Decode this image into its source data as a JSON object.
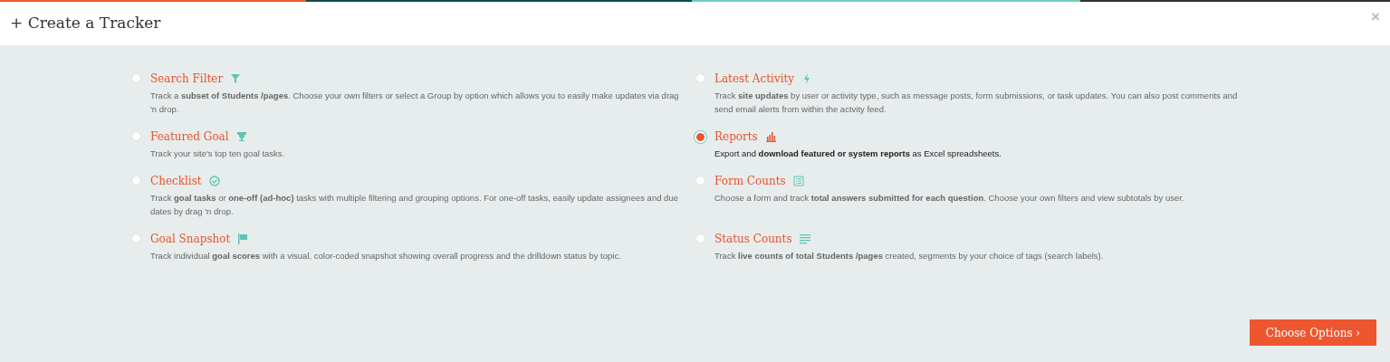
{
  "window": {
    "title": "+ Create a Tracker",
    "close": "×"
  },
  "options": [
    {
      "title": "Search Filter",
      "selected": false,
      "description": "Track a **subset of Students /pages**. Choose your own filters or select a Group by option which allows you to easily make updates via drag 'n drop."
    },
    {
      "title": "Latest Activity",
      "selected": false,
      "description": "Track **site updates** by user or activity type, such as message posts, form submissions, or task updates. You can also post comments and send email alerts from within the actvity feed."
    },
    {
      "title": "Featured Goal",
      "selected": false,
      "description": "Track your site's top ten goal tasks."
    },
    {
      "title": "Reports",
      "selected": true,
      "description": "Export and **download featured or system reports** as Excel spreadsheets."
    },
    {
      "title": "Checklist",
      "selected": false,
      "description": "Track **goal tasks** or **one-off (ad-hoc)** tasks with multiple filtering and grouping options. For one-off tasks, easily update assignees and due dates by drag 'n drop."
    },
    {
      "title": "Form Counts",
      "selected": false,
      "description": "Choose a form and track **total answers submitted for each question**. Choose your own filters and view subtotals by user."
    },
    {
      "title": "Goal Snapshot",
      "selected": false,
      "description": "Track individual **goal scores** with a visual, color-coded snapshot showing overall progress and the drilldown status by topic."
    },
    {
      "title": "Status Counts",
      "selected": false,
      "description": "Track **live counts of total Students /pages** created, segments by your choice of tags (search labels)."
    }
  ],
  "button": {
    "label": "Choose Options",
    "caret": "›"
  }
}
